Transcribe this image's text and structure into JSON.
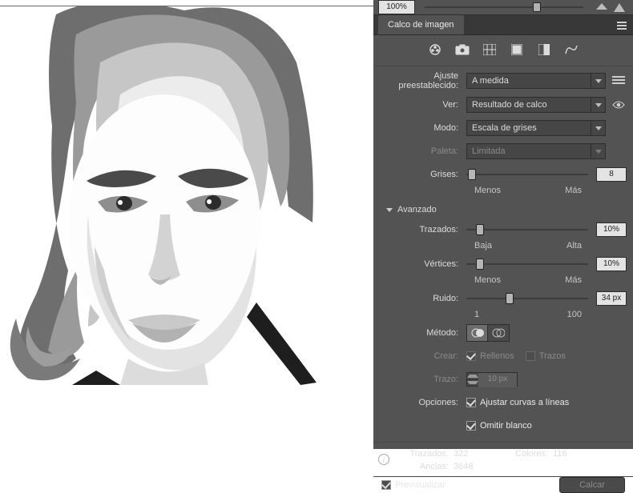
{
  "zoom": {
    "value": "100%"
  },
  "tab": {
    "title": "Calco de imagen"
  },
  "labels": {
    "preset": "Ajuste preestablecido:",
    "view": "Ver:",
    "mode": "Modo:",
    "palette": "Paleta:",
    "grays": "Grises:",
    "grays_min": "Menos",
    "grays_max": "Más",
    "advanced": "Avanzado",
    "paths": "Trazados:",
    "paths_min": "Baja",
    "paths_max": "Alta",
    "corners": "Vértices:",
    "corners_min": "Menos",
    "corners_max": "Más",
    "noise": "Ruido:",
    "noise_min": "1",
    "noise_max": "100",
    "method": "Método:",
    "create": "Crear:",
    "create_fills": "Rellenos",
    "create_strokes": "Trazos",
    "stroke": "Trazo:",
    "options": "Opciones:",
    "opt_snap": "Ajustar curvas a líneas",
    "opt_ignore": "Omitir blanco",
    "preview": "Previsualizar",
    "trace_btn": "Calcar"
  },
  "values": {
    "preset": "A medida",
    "view": "Resultado de calco",
    "mode": "Escala de grises",
    "palette": "Limitada",
    "grays": "8",
    "paths": "10%",
    "corners": "10%",
    "noise": "34 px",
    "stroke": "10 px"
  },
  "stats": {
    "paths_label": "Trazados:",
    "paths_value": "322",
    "colors_label": "Colores:",
    "colors_value": "116",
    "anchors_label": "Anclas:",
    "anchors_value": "3648"
  },
  "chart_data": {
    "type": "table",
    "title": "Image Trace numeric controls",
    "rows": [
      {
        "param": "Grises",
        "value": 8,
        "unit": "",
        "min_label": "Menos",
        "max_label": "Más"
      },
      {
        "param": "Trazados",
        "value": 10,
        "unit": "%",
        "min_label": "Baja",
        "max_label": "Alta"
      },
      {
        "param": "Vértices",
        "value": 10,
        "unit": "%",
        "min_label": "Menos",
        "max_label": "Más"
      },
      {
        "param": "Ruido",
        "value": 34,
        "unit": "px",
        "min_label": "1",
        "max_label": "100"
      }
    ],
    "stats": {
      "Trazados": 322,
      "Colores": 116,
      "Anclas": 3648
    }
  }
}
